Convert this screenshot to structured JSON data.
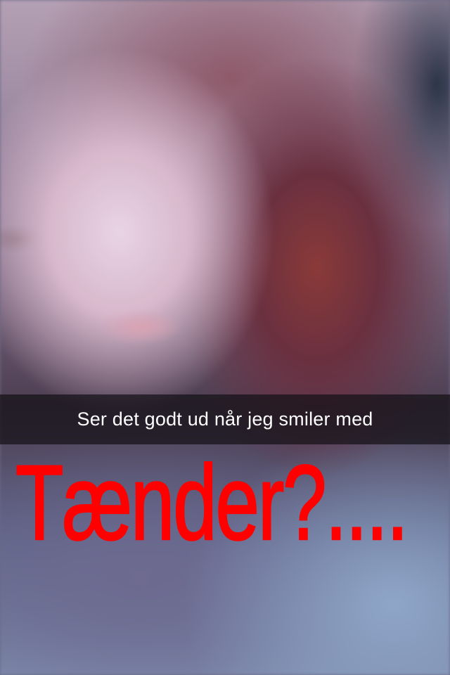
{
  "snap": {
    "caption": "Ser det godt ud når jeg smiler med",
    "drawing_text": "Tænder?....",
    "drawing_color": "#ff0000"
  }
}
